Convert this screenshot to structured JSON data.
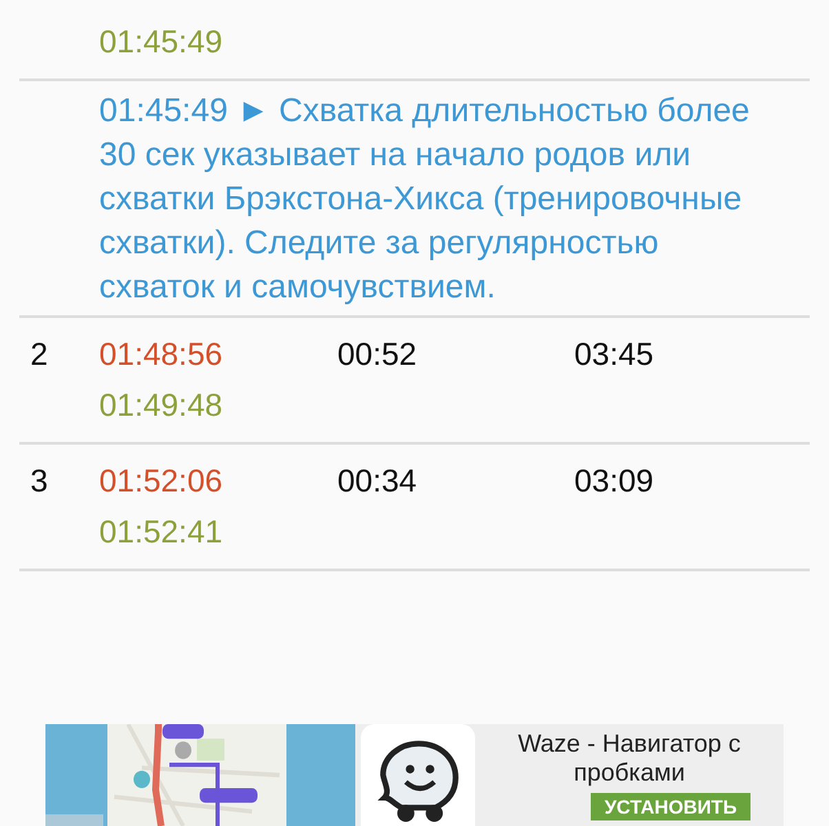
{
  "rows": [
    {
      "number": "",
      "start": "",
      "duration": "",
      "interval": "",
      "end": "01:45:49",
      "note": {
        "time": "01:45:49",
        "marker": "►",
        "text": "Схватка длительностью более 30 сек указывает на начало родов или схватки Брэкстона-Хикса (тренировочные схватки). Следите за регулярностью схваток и самочувствием."
      }
    },
    {
      "number": "2",
      "start": "01:48:56",
      "duration": "00:52",
      "interval": "03:45",
      "end": "01:49:48"
    },
    {
      "number": "3",
      "start": "01:52:06",
      "duration": "00:34",
      "interval": "03:09",
      "end": "01:52:41"
    }
  ],
  "ad": {
    "title": "Waze - Навигатор с пробками",
    "button": "УСТАНОВИТЬ"
  }
}
